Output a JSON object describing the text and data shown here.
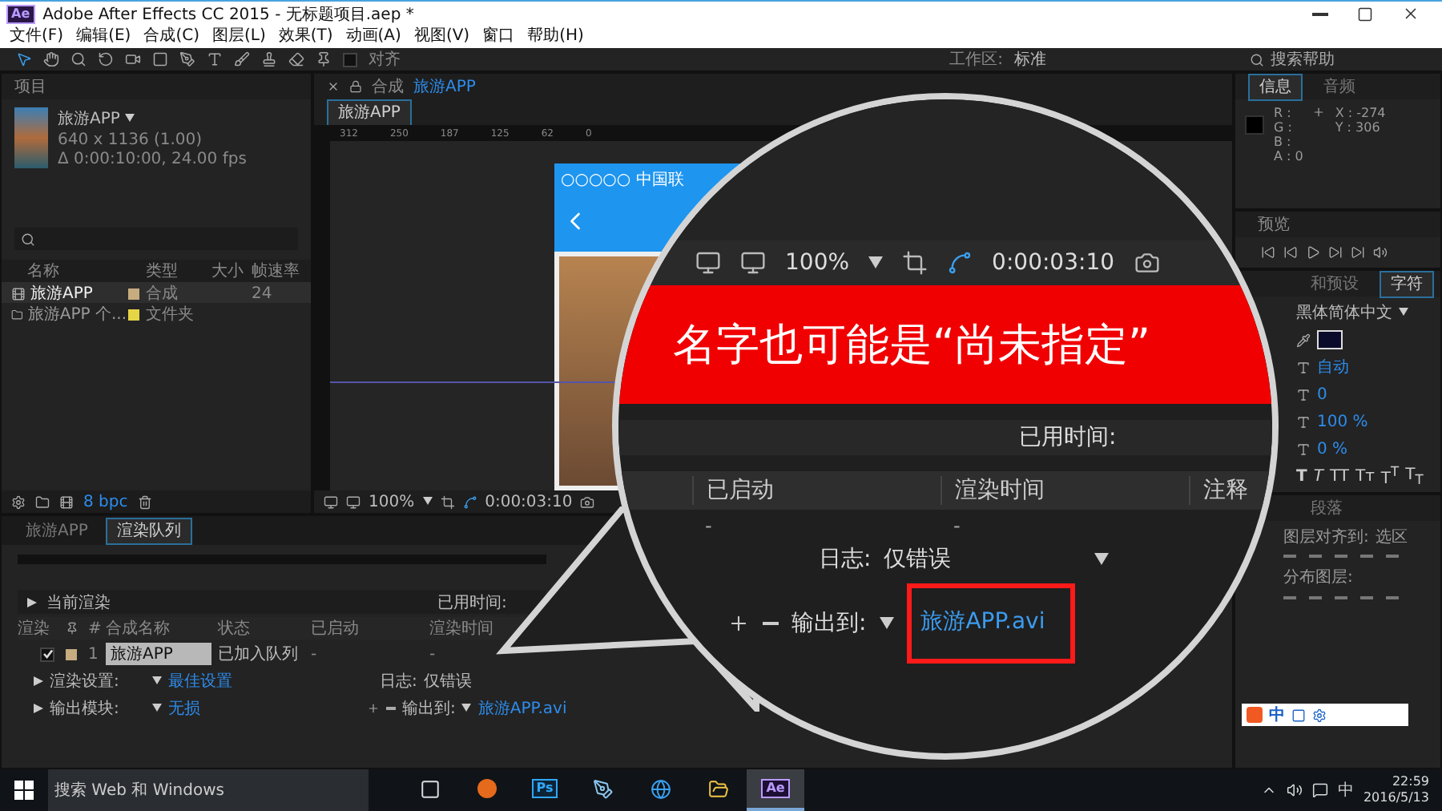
{
  "window": {
    "app_badge": "Ae",
    "title": "Adobe After Effects CC 2015 - 无标题项目.aep *"
  },
  "menu": [
    "文件(F)",
    "编辑(E)",
    "合成(C)",
    "图层(L)",
    "效果(T)",
    "动画(A)",
    "视图(V)",
    "窗口",
    "帮助(H)"
  ],
  "toolbar": {
    "snap_label": "对齐",
    "snap_checked": false,
    "workspace_label": "工作区:",
    "workspace": "标准",
    "search_placeholder": "搜索帮助"
  },
  "project": {
    "title": "项目",
    "item_name": "旅游APP",
    "item_size": "640 x 1136 (1.00)",
    "item_duration": "Δ 0:00:10:00, 24.00 fps",
    "columns": [
      "名称",
      "类型",
      "大小",
      "帧速率"
    ],
    "rows": [
      {
        "kind": "comp",
        "name": "旅游APP",
        "color": "#c7ac80",
        "type": "合成",
        "fps": "24",
        "selected": true
      },
      {
        "kind": "folder",
        "name": "旅游APP 个...",
        "color": "#e6d545",
        "type": "文件夹",
        "selected": false
      }
    ],
    "bpc": "8 bpc"
  },
  "composition": {
    "tab_label": "合成",
    "comp_name": "旅游APP",
    "view_tab": "旅游APP",
    "ruler": [
      "312",
      "250",
      "187",
      "125",
      "62",
      "0"
    ],
    "phone_status": "○○○○○ 中国联",
    "zoom": "100%",
    "timecode": "0:00:03:10"
  },
  "render_queue": {
    "tabs": [
      {
        "label": "旅游APP",
        "selected": false
      },
      {
        "label": "渲染队列",
        "selected": true
      }
    ],
    "current_render": "当前渲染",
    "elapsed_label": "已用时间:",
    "columns": [
      "渲染",
      "#",
      "合成名称",
      "状态",
      "已启动",
      "渲染时间"
    ],
    "item": {
      "checked": true,
      "index": "1",
      "name": "旅游APP",
      "status": "已加入队列",
      "started": "-",
      "render_time": "-"
    },
    "render_settings_label": "渲染设置:",
    "render_settings": "最佳设置",
    "log_label": "日志:",
    "log": "仅错误",
    "output_module_label": "输出模块:",
    "output_module": "无损",
    "output_to_label": "输出到:",
    "output_to": "旅游APP.avi"
  },
  "info": {
    "tabs": [
      {
        "label": "信息",
        "selected": true
      },
      {
        "label": "音频",
        "selected": false
      }
    ],
    "channels": [
      "R :",
      "G :",
      "B :",
      "A : 0"
    ],
    "position": [
      "X : -274",
      "Y : 306"
    ]
  },
  "preview": {
    "title": "预览"
  },
  "character": {
    "tabs": [
      {
        "label": "和预设",
        "selected": false
      },
      {
        "label": "字符",
        "selected": true
      }
    ],
    "font": "黑体简体中文",
    "leading": "自动",
    "tracking": "0",
    "vertical_scale": "100 %",
    "baseline_shift": "0 %",
    "styles": [
      {
        "kind": "bold",
        "label": "T"
      },
      {
        "kind": "italic",
        "label": "T"
      },
      {
        "kind": "plain",
        "label": "TT"
      },
      {
        "kind": "plain",
        "label": "Tᴛ"
      },
      {
        "kind": "plain",
        "label": "T$^{T}$"
      },
      {
        "kind": "plain",
        "label": "T$_{T}$"
      }
    ]
  },
  "align": {
    "tab": "段落",
    "align_label": "图层对齐到:",
    "align_target": "选区",
    "distribute_label": "分布图层:"
  },
  "ime_bar": {
    "label": "中"
  },
  "callout": {
    "zoom": "100%",
    "timecode": "0:00:03:10",
    "banner": "名字也可能是“尚未指定”",
    "elapsed_label": "已用时间:",
    "columns": [
      "已启动",
      "渲染时间",
      "注释"
    ],
    "row": [
      "-",
      "-"
    ],
    "log_label": "日志:",
    "log": "仅错误",
    "output_to_label": "输出到:",
    "output_to": "旅游APP.avi"
  },
  "taskbar": {
    "search": "搜索 Web 和 Windows",
    "apps": [
      {
        "kind": "taskview",
        "selected": false
      },
      {
        "kind": "browser",
        "selected": false
      },
      {
        "kind": "ps",
        "label": "Ps",
        "selected": false
      },
      {
        "kind": "pen",
        "selected": false
      },
      {
        "kind": "globe",
        "selected": false
      },
      {
        "kind": "folder",
        "selected": false
      },
      {
        "kind": "ae",
        "label": "Ae",
        "selected": true
      }
    ],
    "ime": "中",
    "time": "22:59",
    "date": "2016/5/13"
  }
}
